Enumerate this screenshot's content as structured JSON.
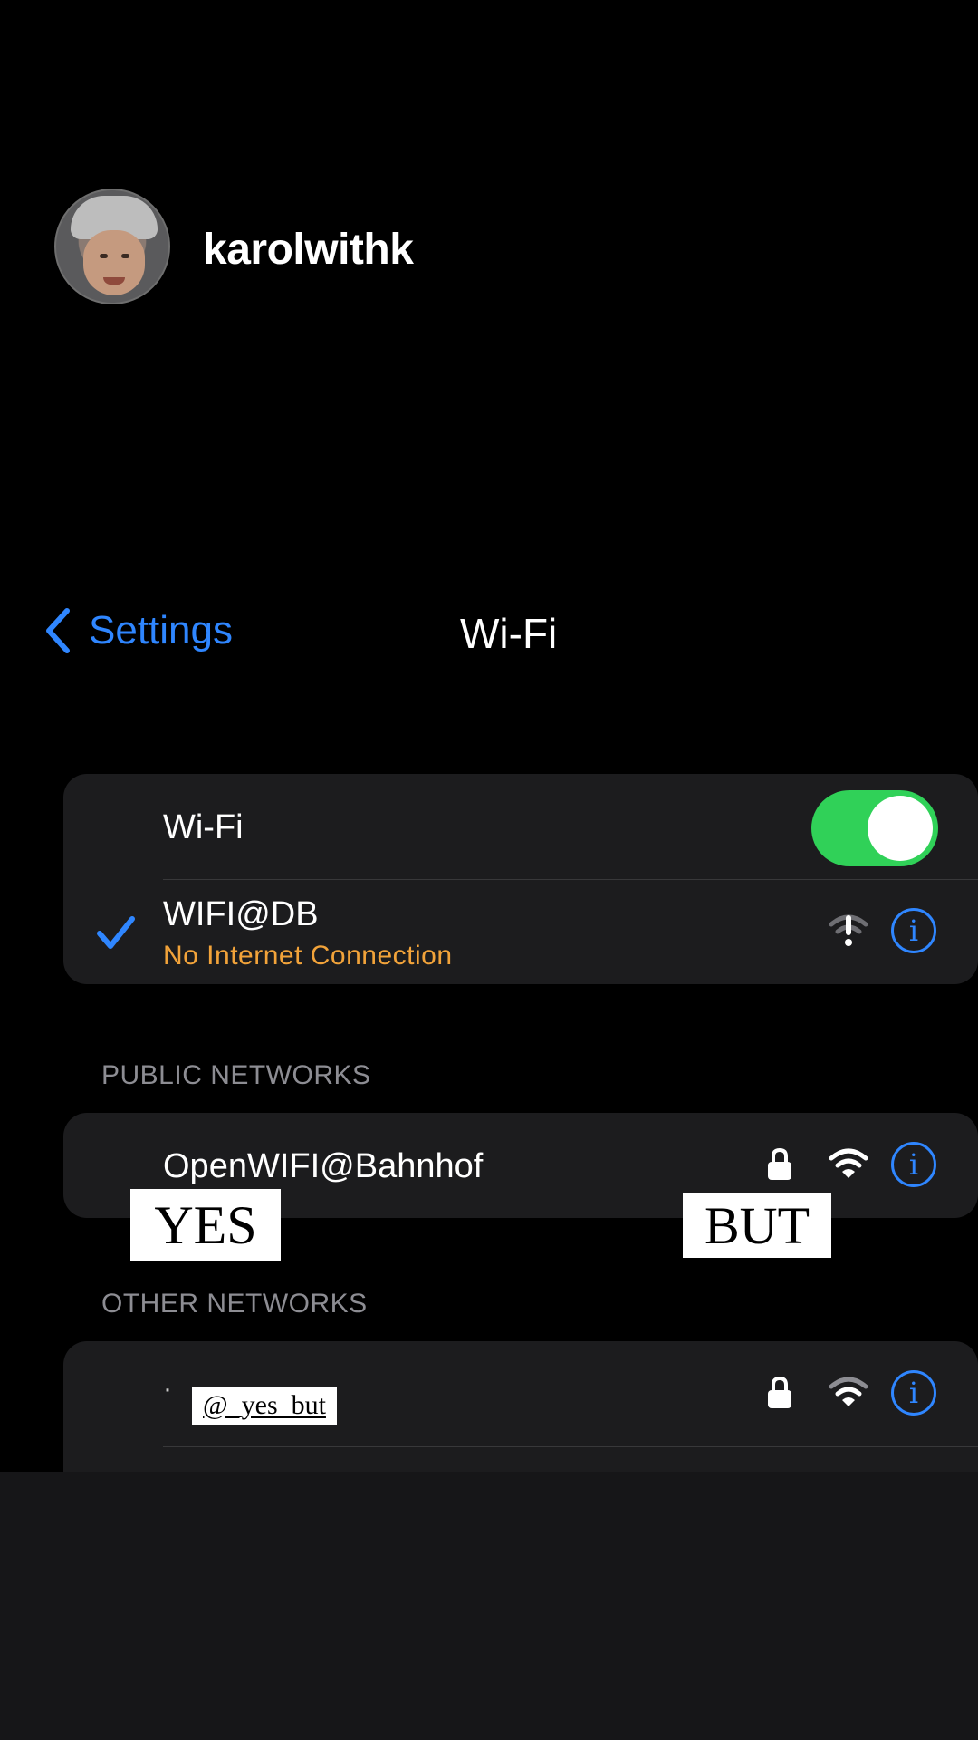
{
  "story": {
    "username": "karolwithk"
  },
  "nav": {
    "back_label": "Settings",
    "title": "Wi-Fi"
  },
  "wifi_group": {
    "toggle_label": "Wi-Fi",
    "toggle_on": true,
    "connected_network": "WIFI@DB",
    "connected_status": "No Internet Connection"
  },
  "public_networks": {
    "header": "PUBLIC NETWORKS",
    "items": [
      {
        "name": "OpenWIFI@Bahnhof",
        "locked": true
      }
    ]
  },
  "other_networks": {
    "header": "OTHER NETWORKS",
    "items": [
      {
        "name": "·",
        "locked": true
      }
    ]
  },
  "stickers": {
    "yes": "YES",
    "but": "BUT",
    "handle": "@_yes_but"
  },
  "colors": {
    "accent": "#2f86ff",
    "toggle": "#30d158",
    "warning": "#f2a33a"
  }
}
